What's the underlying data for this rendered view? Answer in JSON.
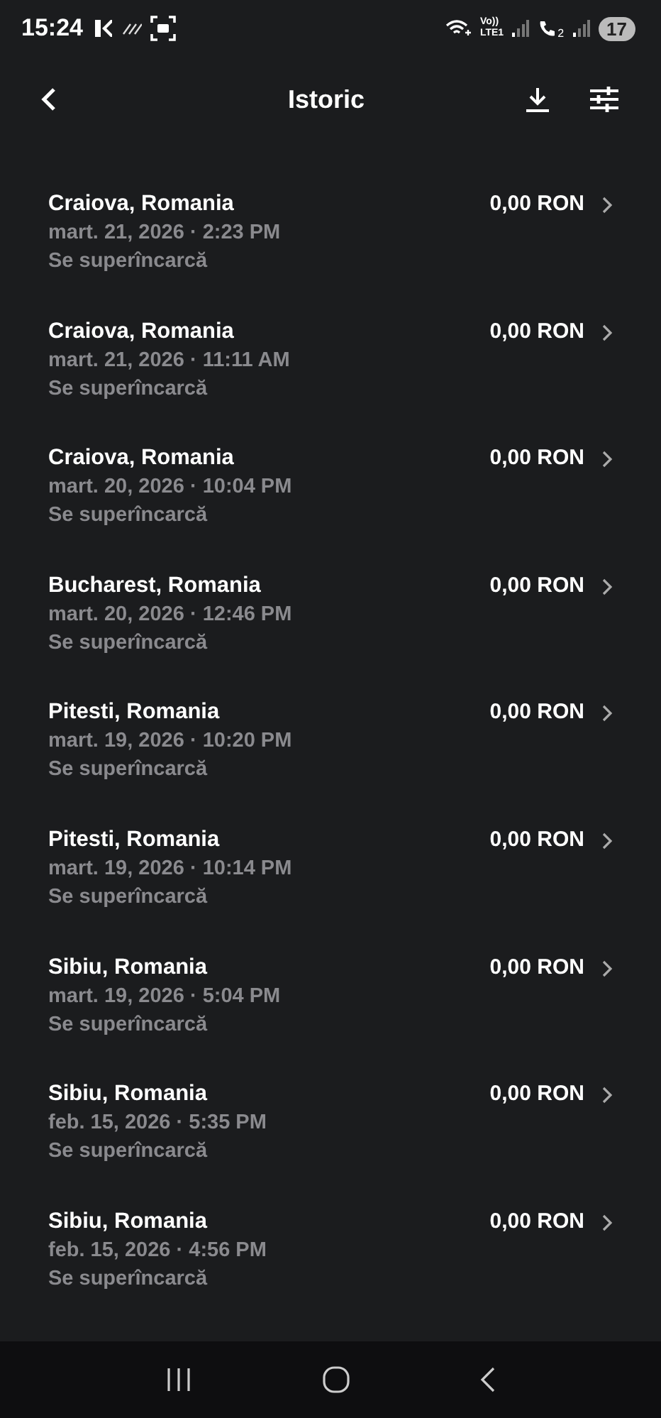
{
  "status_bar": {
    "time": "15:24",
    "network_labels": [
      "Vo))",
      "LTE1"
    ],
    "sim_label": "2",
    "battery": "17"
  },
  "header": {
    "title": "Istoric"
  },
  "sessions": [
    {
      "location": "Craiova, Romania",
      "datetime": "mart. 21, 2026 · 2:23 PM",
      "status": "Se superîncarcă",
      "amount": "0,00 RON"
    },
    {
      "location": "Craiova, Romania",
      "datetime": "mart. 21, 2026 · 11:11 AM",
      "status": "Se superîncarcă",
      "amount": "0,00 RON"
    },
    {
      "location": "Craiova, Romania",
      "datetime": "mart. 20, 2026 · 10:04 PM",
      "status": "Se superîncarcă",
      "amount": "0,00 RON"
    },
    {
      "location": "Bucharest, Romania",
      "datetime": "mart. 20, 2026 · 12:46 PM",
      "status": "Se superîncarcă",
      "amount": "0,00 RON"
    },
    {
      "location": "Pitesti, Romania",
      "datetime": "mart. 19, 2026 · 10:20 PM",
      "status": "Se superîncarcă",
      "amount": "0,00 RON"
    },
    {
      "location": "Pitesti, Romania",
      "datetime": "mart. 19, 2026 · 10:14 PM",
      "status": "Se superîncarcă",
      "amount": "0,00 RON"
    },
    {
      "location": "Sibiu, Romania",
      "datetime": "mart. 19, 2026 · 5:04 PM",
      "status": "Se superîncarcă",
      "amount": "0,00 RON"
    },
    {
      "location": "Sibiu, Romania",
      "datetime": "feb. 15, 2026 · 5:35 PM",
      "status": "Se superîncarcă",
      "amount": "0,00 RON"
    },
    {
      "location": "Sibiu, Romania",
      "datetime": "feb. 15, 2026 · 4:56 PM",
      "status": "Se superîncarcă",
      "amount": "0,00 RON"
    }
  ]
}
